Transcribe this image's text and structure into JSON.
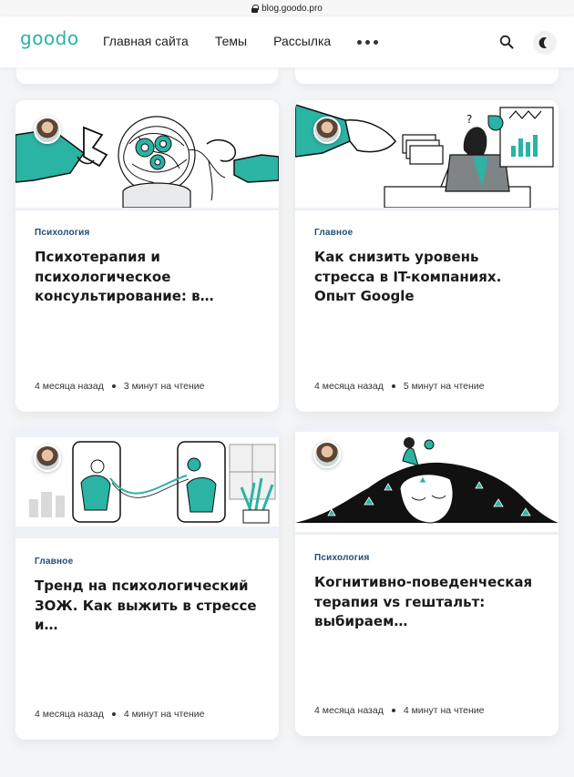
{
  "browser": {
    "url": "blog.goodo.pro"
  },
  "header": {
    "logo": "goodo",
    "nav": [
      "Главная сайта",
      "Темы",
      "Рассылка"
    ],
    "more_icon": "more-dots-icon",
    "search_icon": "search-icon",
    "theme_icon": "moon-icon"
  },
  "colors": {
    "brand": "#2bb3a3",
    "tag": "#1f4d75"
  },
  "posts": [
    {
      "tag": "Психология",
      "title": "Психотерапия и психологическое консультирование: в…",
      "date": "4 месяца назад",
      "read": "3 минут на чтение"
    },
    {
      "tag": "Главное",
      "title": "Как снизить уровень стресса в IT-компаниях. Опыт Google",
      "date": "4 месяца назад",
      "read": "5 минут на чтение"
    },
    {
      "tag": "Главное",
      "title": "Тренд на психологический ЗОЖ. Как выжить в стрессе и…",
      "date": "4 месяца назад",
      "read": "4 минут на чтение"
    },
    {
      "tag": "Психология",
      "title": "Когнитивно-поведенческая терапия vs гештальт: выбираем…",
      "date": "4 месяца назад",
      "read": "4 минут на чтение"
    }
  ]
}
